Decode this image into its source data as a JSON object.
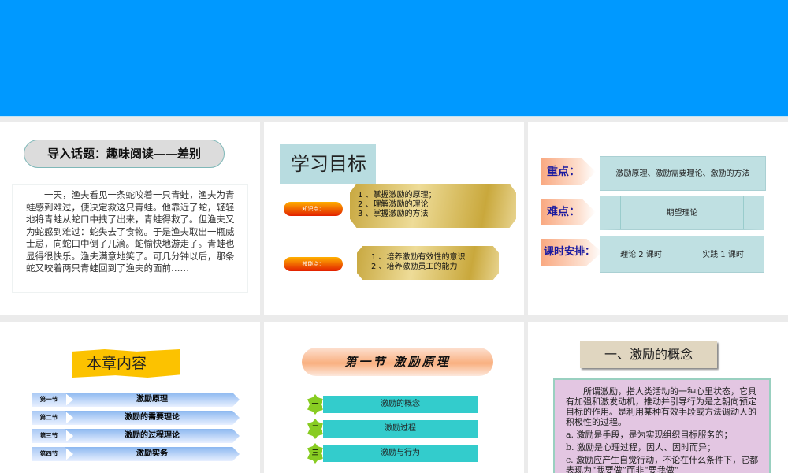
{
  "slide1": {
    "title": "导入话题：趣味阅读——差别",
    "story": "一天，渔夫看见一条蛇咬着一只青蛙，渔夫为青蛙感到难过，便决定救这只青蛙。他靠近了蛇，轻轻地将青蛙从蛇口中拽了出来，青蛙得救了。但渔夫又为蛇感到难过：蛇失去了食物。于是渔夫取出一瓶威士忌，向蛇口中倒了几滴。蛇愉快地游走了。青蛙也显得很快乐。渔夫满意地笑了。可几分钟以后，那条蛇又咬着两只青蛙回到了渔夫的面前……"
  },
  "slide2": {
    "title": "学习目标",
    "knowledge_label": "知识点：",
    "knowledge": [
      "1 、掌握激励的原理；",
      "2 、理解激励的理论",
      "3 、掌握激励的方法"
    ],
    "skill_label": "技能点：",
    "skills": [
      "1 、培养激励有效性的意识",
      "2 、培养激励员工的能力"
    ]
  },
  "slide3": {
    "key_label": "重点：",
    "key": "激励原理、激励需要理论、激励的方法",
    "hard_label": "难点：",
    "hard": "期望理论",
    "hours_label": "课时安排：",
    "theory": "理论 2 课时",
    "practice": "实践 1 课时"
  },
  "slide4": {
    "title": "本章内容",
    "sections": [
      {
        "num": "第一节",
        "name": "激励原理"
      },
      {
        "num": "第二节",
        "name": "激励的需要理论"
      },
      {
        "num": "第三节",
        "name": "激励的过程理论"
      },
      {
        "num": "第四节",
        "name": "激励实务"
      }
    ]
  },
  "slide5": {
    "title": "第一节  激励原理",
    "items": [
      {
        "num": "一",
        "name": "激励的概念"
      },
      {
        "num": "二",
        "name": "激励过程"
      },
      {
        "num": "三",
        "name": "激励与行为"
      }
    ]
  },
  "slide6": {
    "title": "一、激励的概念",
    "para": "所谓激励，指人类活动的一种心里状态，它具有加强和激发动机，推动并引导行为是之朝向预定目标的作用。是利用某种有效手段或方法调动人的积极性的过程。",
    "points": [
      "a. 激励是手段，是为实现组织目标服务的；",
      "b. 激励是心理过程，因人、因时而异；",
      "c. 激励应产生自觉行动，不论在什么条件下，它都表现为“我要做”而非“要我做”"
    ]
  }
}
